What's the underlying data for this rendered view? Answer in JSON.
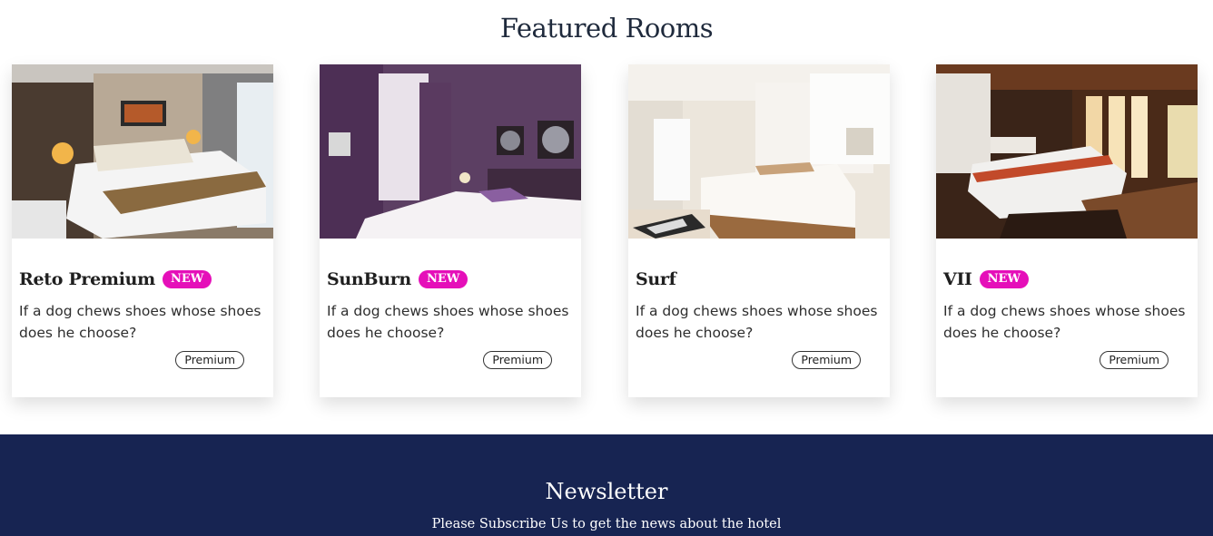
{
  "featured": {
    "title": "Featured Rooms",
    "rooms": [
      {
        "name": "Reto Premium",
        "badge": "NEW",
        "description": "If a dog chews shoes whose shoes does he choose?",
        "tag": "Premium"
      },
      {
        "name": "SunBurn",
        "badge": "NEW",
        "description": "If a dog chews shoes whose shoes does he choose?",
        "tag": "Premium"
      },
      {
        "name": "Surf",
        "badge": "",
        "description": "If a dog chews shoes whose shoes does he choose?",
        "tag": "Premium"
      },
      {
        "name": "VII",
        "badge": "NEW",
        "description": "If a dog chews shoes whose shoes does he choose?",
        "tag": "Premium"
      }
    ]
  },
  "newsletter": {
    "title": "Newsletter",
    "subtitle": "Please Subscribe Us to get the news about the hotel"
  },
  "colors": {
    "badge": "#e50fb9",
    "newsletter_bg": "#172452",
    "heading": "#1f2a3c"
  }
}
